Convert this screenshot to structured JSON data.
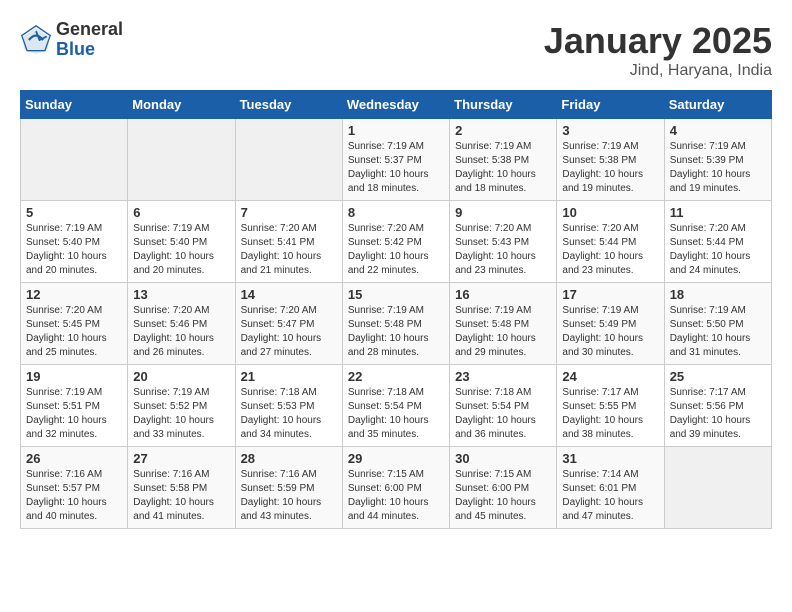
{
  "header": {
    "logo_general": "General",
    "logo_blue": "Blue",
    "month_title": "January 2025",
    "location": "Jind, Haryana, India"
  },
  "weekdays": [
    "Sunday",
    "Monday",
    "Tuesday",
    "Wednesday",
    "Thursday",
    "Friday",
    "Saturday"
  ],
  "weeks": [
    [
      {
        "day": "",
        "content": ""
      },
      {
        "day": "",
        "content": ""
      },
      {
        "day": "",
        "content": ""
      },
      {
        "day": "1",
        "content": "Sunrise: 7:19 AM\nSunset: 5:37 PM\nDaylight: 10 hours\nand 18 minutes."
      },
      {
        "day": "2",
        "content": "Sunrise: 7:19 AM\nSunset: 5:38 PM\nDaylight: 10 hours\nand 18 minutes."
      },
      {
        "day": "3",
        "content": "Sunrise: 7:19 AM\nSunset: 5:38 PM\nDaylight: 10 hours\nand 19 minutes."
      },
      {
        "day": "4",
        "content": "Sunrise: 7:19 AM\nSunset: 5:39 PM\nDaylight: 10 hours\nand 19 minutes."
      }
    ],
    [
      {
        "day": "5",
        "content": "Sunrise: 7:19 AM\nSunset: 5:40 PM\nDaylight: 10 hours\nand 20 minutes."
      },
      {
        "day": "6",
        "content": "Sunrise: 7:19 AM\nSunset: 5:40 PM\nDaylight: 10 hours\nand 20 minutes."
      },
      {
        "day": "7",
        "content": "Sunrise: 7:20 AM\nSunset: 5:41 PM\nDaylight: 10 hours\nand 21 minutes."
      },
      {
        "day": "8",
        "content": "Sunrise: 7:20 AM\nSunset: 5:42 PM\nDaylight: 10 hours\nand 22 minutes."
      },
      {
        "day": "9",
        "content": "Sunrise: 7:20 AM\nSunset: 5:43 PM\nDaylight: 10 hours\nand 23 minutes."
      },
      {
        "day": "10",
        "content": "Sunrise: 7:20 AM\nSunset: 5:44 PM\nDaylight: 10 hours\nand 23 minutes."
      },
      {
        "day": "11",
        "content": "Sunrise: 7:20 AM\nSunset: 5:44 PM\nDaylight: 10 hours\nand 24 minutes."
      }
    ],
    [
      {
        "day": "12",
        "content": "Sunrise: 7:20 AM\nSunset: 5:45 PM\nDaylight: 10 hours\nand 25 minutes."
      },
      {
        "day": "13",
        "content": "Sunrise: 7:20 AM\nSunset: 5:46 PM\nDaylight: 10 hours\nand 26 minutes."
      },
      {
        "day": "14",
        "content": "Sunrise: 7:20 AM\nSunset: 5:47 PM\nDaylight: 10 hours\nand 27 minutes."
      },
      {
        "day": "15",
        "content": "Sunrise: 7:19 AM\nSunset: 5:48 PM\nDaylight: 10 hours\nand 28 minutes."
      },
      {
        "day": "16",
        "content": "Sunrise: 7:19 AM\nSunset: 5:48 PM\nDaylight: 10 hours\nand 29 minutes."
      },
      {
        "day": "17",
        "content": "Sunrise: 7:19 AM\nSunset: 5:49 PM\nDaylight: 10 hours\nand 30 minutes."
      },
      {
        "day": "18",
        "content": "Sunrise: 7:19 AM\nSunset: 5:50 PM\nDaylight: 10 hours\nand 31 minutes."
      }
    ],
    [
      {
        "day": "19",
        "content": "Sunrise: 7:19 AM\nSunset: 5:51 PM\nDaylight: 10 hours\nand 32 minutes."
      },
      {
        "day": "20",
        "content": "Sunrise: 7:19 AM\nSunset: 5:52 PM\nDaylight: 10 hours\nand 33 minutes."
      },
      {
        "day": "21",
        "content": "Sunrise: 7:18 AM\nSunset: 5:53 PM\nDaylight: 10 hours\nand 34 minutes."
      },
      {
        "day": "22",
        "content": "Sunrise: 7:18 AM\nSunset: 5:54 PM\nDaylight: 10 hours\nand 35 minutes."
      },
      {
        "day": "23",
        "content": "Sunrise: 7:18 AM\nSunset: 5:54 PM\nDaylight: 10 hours\nand 36 minutes."
      },
      {
        "day": "24",
        "content": "Sunrise: 7:17 AM\nSunset: 5:55 PM\nDaylight: 10 hours\nand 38 minutes."
      },
      {
        "day": "25",
        "content": "Sunrise: 7:17 AM\nSunset: 5:56 PM\nDaylight: 10 hours\nand 39 minutes."
      }
    ],
    [
      {
        "day": "26",
        "content": "Sunrise: 7:16 AM\nSunset: 5:57 PM\nDaylight: 10 hours\nand 40 minutes."
      },
      {
        "day": "27",
        "content": "Sunrise: 7:16 AM\nSunset: 5:58 PM\nDaylight: 10 hours\nand 41 minutes."
      },
      {
        "day": "28",
        "content": "Sunrise: 7:16 AM\nSunset: 5:59 PM\nDaylight: 10 hours\nand 43 minutes."
      },
      {
        "day": "29",
        "content": "Sunrise: 7:15 AM\nSunset: 6:00 PM\nDaylight: 10 hours\nand 44 minutes."
      },
      {
        "day": "30",
        "content": "Sunrise: 7:15 AM\nSunset: 6:00 PM\nDaylight: 10 hours\nand 45 minutes."
      },
      {
        "day": "31",
        "content": "Sunrise: 7:14 AM\nSunset: 6:01 PM\nDaylight: 10 hours\nand 47 minutes."
      },
      {
        "day": "",
        "content": ""
      }
    ]
  ]
}
